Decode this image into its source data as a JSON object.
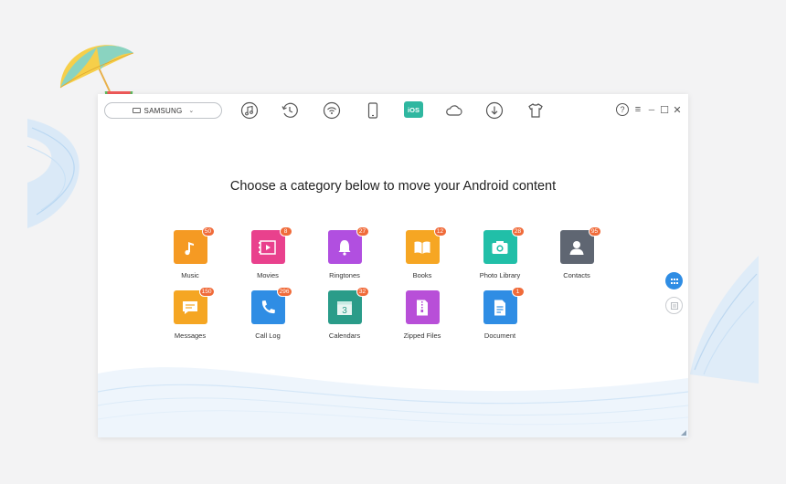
{
  "device": {
    "name": "SAMSUNG",
    "icon": "phone-device-icon",
    "dropdown_icon": "chevron-down-icon"
  },
  "toolbar": [
    {
      "name": "music-manager",
      "icon": "music-note-icon"
    },
    {
      "name": "backup-history",
      "icon": "history-clock-icon"
    },
    {
      "name": "wifi-transfer",
      "icon": "wifi-icon"
    },
    {
      "name": "device-manager",
      "icon": "phone-icon"
    },
    {
      "name": "ios-to-android",
      "icon": "ios-icon",
      "label": "iOS",
      "active": true
    },
    {
      "name": "cloud-manager",
      "icon": "cloud-icon"
    },
    {
      "name": "downloader",
      "icon": "download-icon"
    },
    {
      "name": "toolkit",
      "icon": "shirt-icon"
    }
  ],
  "window_controls": {
    "help": "?",
    "menu": "≡",
    "minimize": "─",
    "maximize": "☐",
    "close": "✕"
  },
  "headline": "Choose a category below to move your Android content",
  "categories": [
    {
      "label": "Music",
      "count": "50",
      "color": "#f59a23",
      "icon": "music-icon"
    },
    {
      "label": "Movies",
      "count": "8",
      "color": "#e9418d",
      "icon": "movie-icon"
    },
    {
      "label": "Ringtones",
      "count": "27",
      "color": "#b14fe0",
      "icon": "bell-icon"
    },
    {
      "label": "Books",
      "count": "12",
      "color": "#f6a623",
      "icon": "book-icon"
    },
    {
      "label": "Photo Library",
      "count": "28",
      "color": "#21bfa8",
      "icon": "camera-icon"
    },
    {
      "label": "Contacts",
      "count": "95",
      "color": "#5f6672",
      "icon": "contact-icon"
    },
    {
      "label": "Messages",
      "count": "150",
      "color": "#f5a623",
      "icon": "message-icon"
    },
    {
      "label": "Call Log",
      "count": "296",
      "color": "#2f8de4",
      "icon": "phone-call-icon"
    },
    {
      "label": "Calendars",
      "count": "32",
      "color": "#2a9c89",
      "icon": "calendar-icon",
      "glyph": "3"
    },
    {
      "label": "Zipped Files",
      "count": "",
      "color": "#b84fd8",
      "icon": "zip-file-icon"
    },
    {
      "label": "Document",
      "count": "1",
      "color": "#2f8de4",
      "icon": "document-icon"
    }
  ],
  "side_buttons": [
    {
      "name": "grid-view",
      "icon": "grid-view-icon",
      "active": true
    },
    {
      "name": "list-view",
      "icon": "list-view-icon",
      "active": false
    }
  ]
}
